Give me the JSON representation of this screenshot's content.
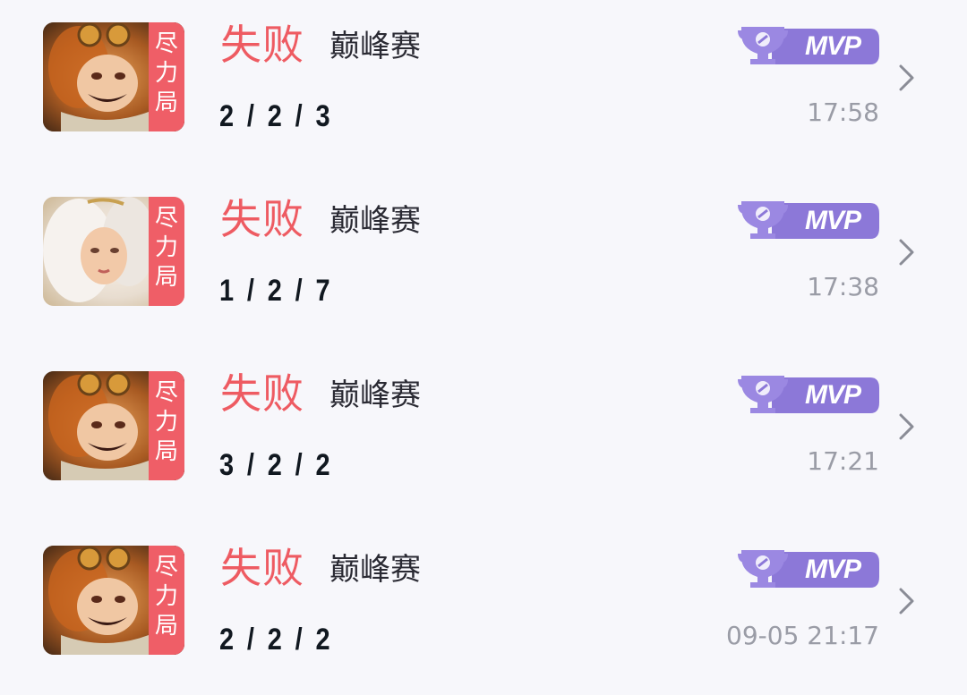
{
  "matches": [
    {
      "effort_tag": [
        "尽",
        "力",
        "局"
      ],
      "hero_icon": "hero-portrait-goggles",
      "result": "失败",
      "mode": "巅峰赛",
      "kda": "2 / 2 / 3",
      "badge": "MVP",
      "time": "17:58"
    },
    {
      "effort_tag": [
        "尽",
        "力",
        "局"
      ],
      "hero_icon": "hero-portrait-white-hair",
      "result": "失败",
      "mode": "巅峰赛",
      "kda": "1 / 2 / 7",
      "badge": "MVP",
      "time": "17:38"
    },
    {
      "effort_tag": [
        "尽",
        "力",
        "局"
      ],
      "hero_icon": "hero-portrait-goggles",
      "result": "失败",
      "mode": "巅峰赛",
      "kda": "3 / 2 / 2",
      "badge": "MVP",
      "time": "17:21"
    },
    {
      "effort_tag": [
        "尽",
        "力",
        "局"
      ],
      "hero_icon": "hero-portrait-goggles",
      "result": "失败",
      "mode": "巅峰赛",
      "kda": "2 / 2 / 2",
      "badge": "MVP",
      "time": "09-05 21:17"
    }
  ],
  "colors": {
    "loss": "#ee5b62",
    "effort_tag": "#ef5e67",
    "mvp_badge": "#8c78d8",
    "time": "#9a9ca6",
    "background": "#f7f7fb"
  }
}
